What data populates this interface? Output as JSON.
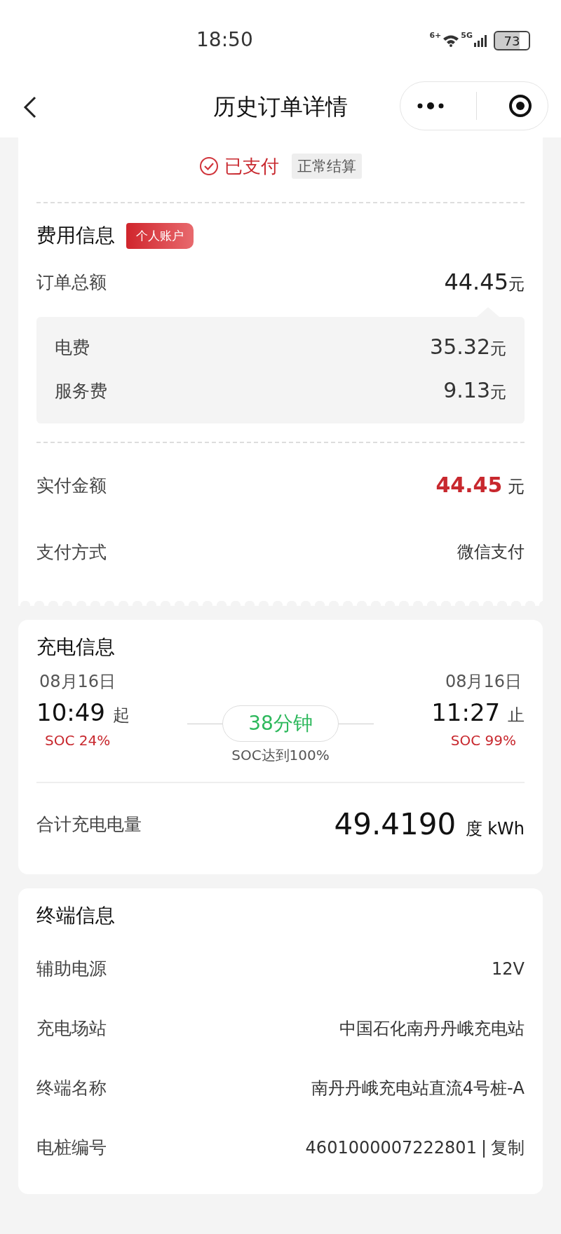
{
  "status_bar": {
    "time": "18:50",
    "wifi_label": "6+",
    "network": "5G",
    "battery": "73"
  },
  "nav": {
    "title": "历史订单详情"
  },
  "order": {
    "status": "已支付",
    "settlement_tag": "正常结算"
  },
  "fees": {
    "title": "费用信息",
    "account_badge": "个人账户",
    "total": {
      "label": "订单总额",
      "amount": "44.45",
      "unit": "元"
    },
    "breakdown": [
      {
        "label": "电费",
        "amount": "35.32",
        "unit": "元"
      },
      {
        "label": "服务费",
        "amount": "9.13",
        "unit": "元"
      }
    ],
    "paid": {
      "label": "实付金额",
      "amount": "44.45",
      "unit": "元"
    },
    "method": {
      "label": "支付方式",
      "value": "微信支付"
    }
  },
  "charging": {
    "title": "充电信息",
    "start": {
      "date": "08月16日",
      "time": "10:49",
      "mark": "起",
      "soc": "SOC 24%"
    },
    "duration": "38分钟",
    "target": "SOC达到100%",
    "end": {
      "date": "08月16日",
      "time": "11:27",
      "mark": "止",
      "soc": "SOC 99%"
    },
    "energy": {
      "label": "合计充电电量",
      "value": "49.4190",
      "unit": "度 kWh"
    }
  },
  "terminal": {
    "title": "终端信息",
    "rows": [
      {
        "label": "辅助电源",
        "value": "12V"
      },
      {
        "label": "充电场站",
        "value": "中国石化南丹丹峨充电站"
      },
      {
        "label": "终端名称",
        "value": "南丹丹峨充电站直流4号桩-A"
      }
    ],
    "pile": {
      "label": "电桩编号",
      "value": "4601000007222801",
      "separator": "|",
      "action": "复制"
    }
  }
}
